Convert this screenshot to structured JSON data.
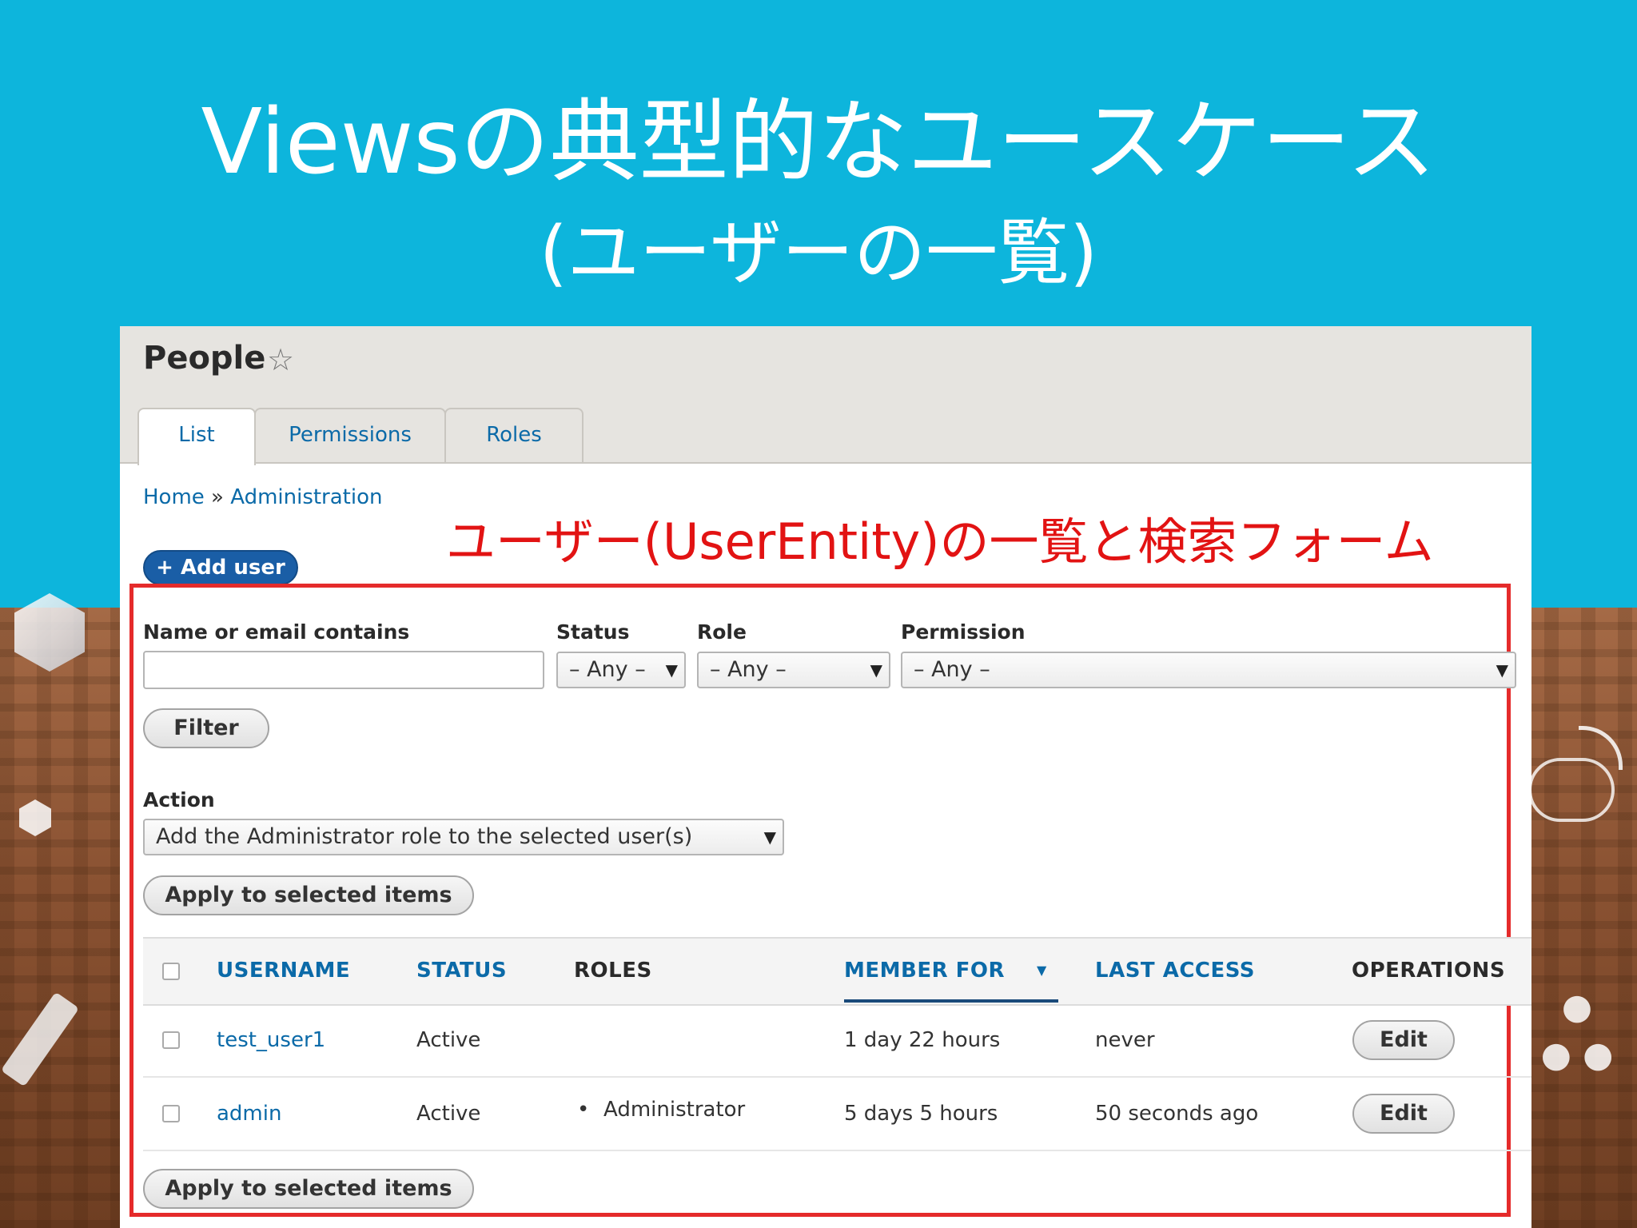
{
  "slide": {
    "title_line1": "Viewsの典型的なユースケース",
    "title_line2": "(ユーザーの一覧)",
    "annotation": "ユーザー(UserEntity)の一覧と検索フォーム",
    "colors": {
      "background": "#0db5dc",
      "annotation": "#e21313",
      "highlight_box": "#e52b2b"
    }
  },
  "page": {
    "title": "People",
    "favorite_icon": "star-outline-icon",
    "tabs": [
      {
        "label": "List",
        "active": true
      },
      {
        "label": "Permissions",
        "active": false
      },
      {
        "label": "Roles",
        "active": false
      }
    ],
    "breadcrumb": {
      "home": "Home",
      "separator": "»",
      "admin": "Administration"
    },
    "add_user": "+ Add user"
  },
  "filters": {
    "name_label": "Name or email contains",
    "name_value": "",
    "status_label": "Status",
    "status_value": "– Any –",
    "role_label": "Role",
    "role_value": "– Any –",
    "permission_label": "Permission",
    "permission_value": "– Any –",
    "filter_button": "Filter"
  },
  "bulk": {
    "action_label": "Action",
    "action_value": "Add the Administrator role to the selected user(s)",
    "apply_button": "Apply to selected items"
  },
  "table": {
    "headers": {
      "username": "USERNAME",
      "status": "STATUS",
      "roles": "ROLES",
      "member_for": "MEMBER FOR",
      "last_access": "LAST ACCESS",
      "operations": "OPERATIONS"
    },
    "rows": [
      {
        "username": "test_user1",
        "status": "Active",
        "roles": "",
        "member_for": "1 day 22 hours",
        "last_access": "never",
        "operation": "Edit"
      },
      {
        "username": "admin",
        "status": "Active",
        "roles": "Administrator",
        "member_for": "5 days 5 hours",
        "last_access": "50 seconds ago",
        "operation": "Edit"
      }
    ]
  }
}
